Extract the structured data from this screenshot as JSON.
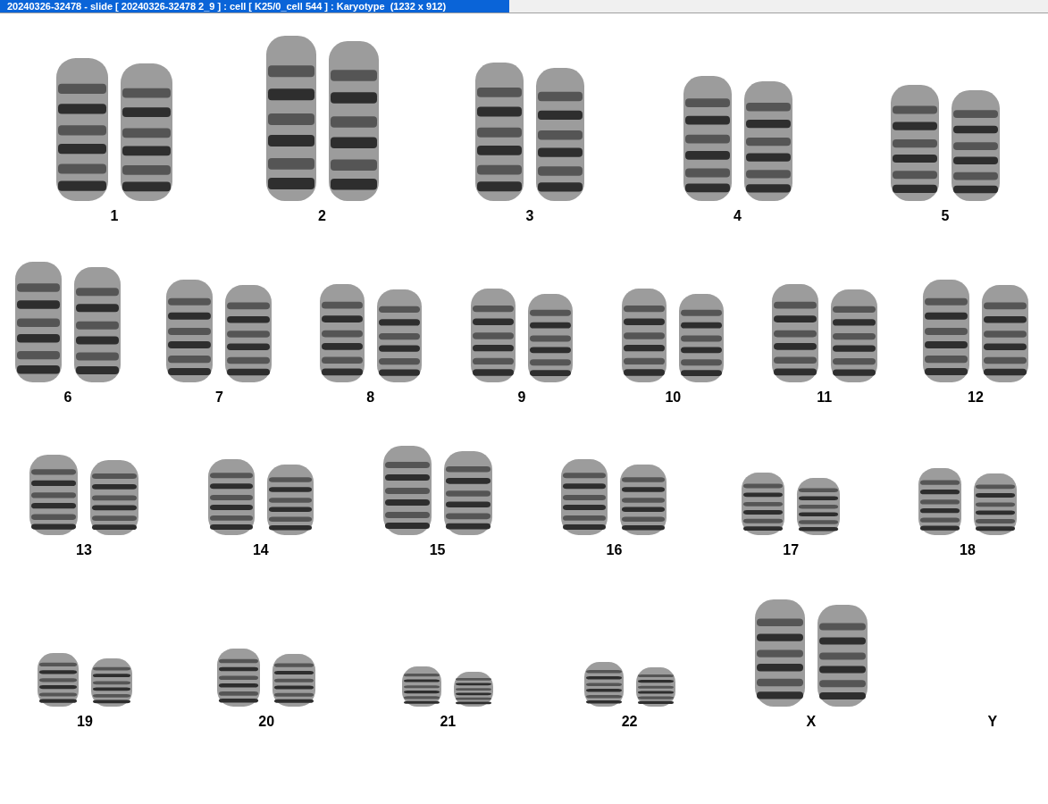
{
  "window": {
    "title": "20240326-32478 - slide [ 20240326-32478 2_9 ] : cell [ K25/0_cell 544 ] : Karyotype  (1232 x 912)"
  },
  "karyotype": {
    "rows": [
      [
        {
          "label": "1",
          "kind": "pair"
        },
        {
          "label": "2",
          "kind": "pair"
        },
        {
          "label": "3",
          "kind": "pair"
        },
        {
          "label": "4",
          "kind": "pair"
        },
        {
          "label": "5",
          "kind": "pair"
        }
      ],
      [
        {
          "label": "6",
          "kind": "pair"
        },
        {
          "label": "7",
          "kind": "pair"
        },
        {
          "label": "8",
          "kind": "pair"
        },
        {
          "label": "9",
          "kind": "pair"
        },
        {
          "label": "10",
          "kind": "pair"
        },
        {
          "label": "11",
          "kind": "pair"
        },
        {
          "label": "12",
          "kind": "pair"
        }
      ],
      [
        {
          "label": "13",
          "kind": "pair"
        },
        {
          "label": "14",
          "kind": "pair"
        },
        {
          "label": "15",
          "kind": "pair"
        },
        {
          "label": "16",
          "kind": "pair"
        },
        {
          "label": "17",
          "kind": "pair"
        },
        {
          "label": "18",
          "kind": "pair"
        }
      ],
      [
        {
          "label": "19",
          "kind": "pair"
        },
        {
          "label": "20",
          "kind": "pair"
        },
        {
          "label": "21",
          "kind": "pair"
        },
        {
          "label": "22",
          "kind": "pair"
        },
        {
          "label": "X",
          "kind": "pair"
        },
        {
          "label": "Y",
          "kind": "empty"
        }
      ]
    ]
  }
}
